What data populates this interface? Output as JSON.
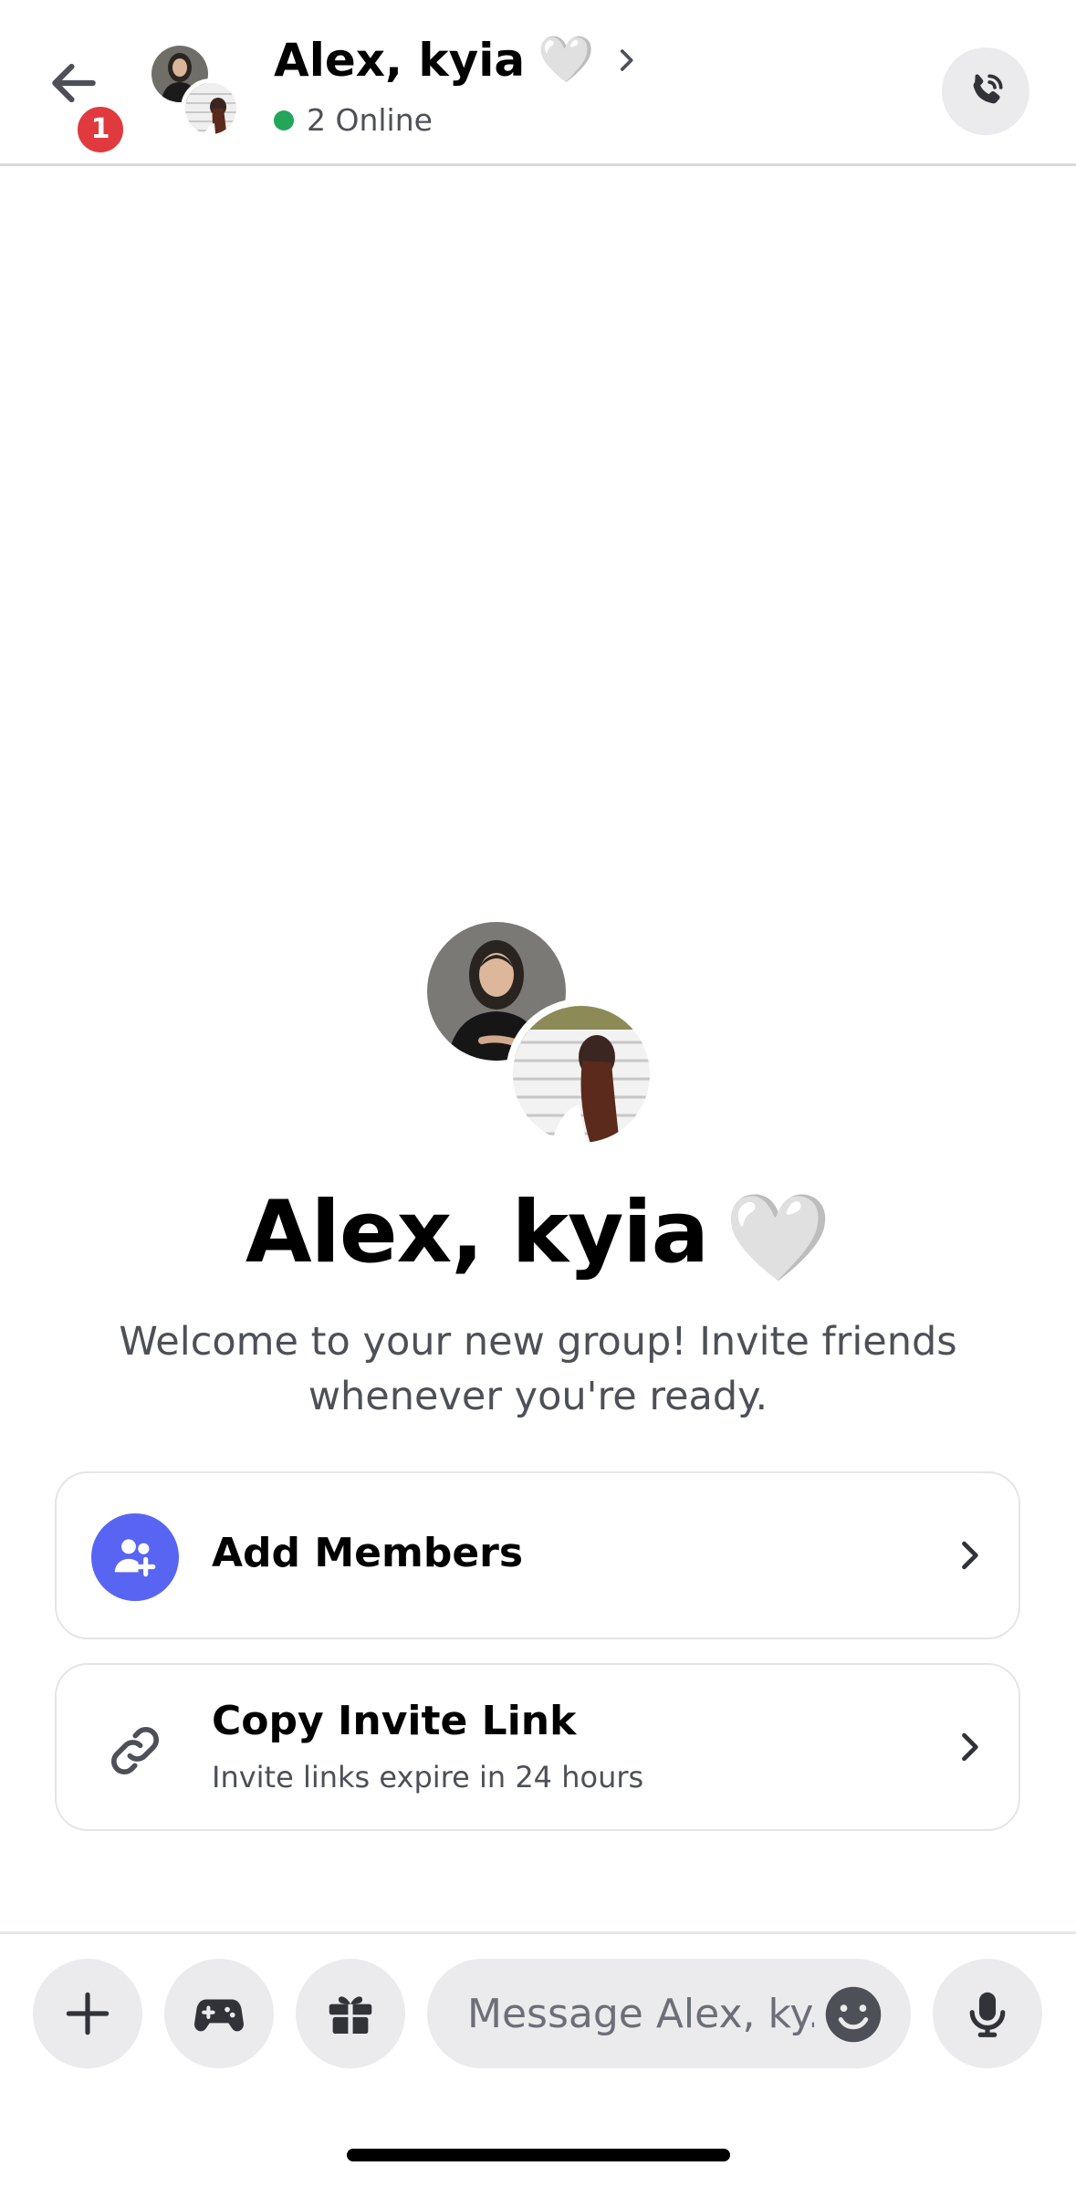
{
  "header": {
    "title": "Alex, kyia",
    "title_emoji": "🤍",
    "status": "2 Online",
    "notification_count": "1"
  },
  "group": {
    "name": "Alex, kyia",
    "emoji": "🤍",
    "welcome": "Welcome to your new group! Invite friends whenever you're ready."
  },
  "actions": {
    "add_members": "Add Members",
    "copy_invite": "Copy Invite Link",
    "copy_invite_sub": "Invite links expire in 24 hours"
  },
  "composer": {
    "placeholder": "Message Alex, ky..."
  },
  "colors": {
    "accent": "#5865f2",
    "online": "#23a55a",
    "badge": "#e03a3e"
  },
  "icons": [
    "back-arrow-icon",
    "phone-call-icon",
    "add-user-icon",
    "link-icon",
    "plus-icon",
    "gamepad-icon",
    "gift-icon",
    "emoji-icon",
    "microphone-icon",
    "chevron-right-icon"
  ]
}
